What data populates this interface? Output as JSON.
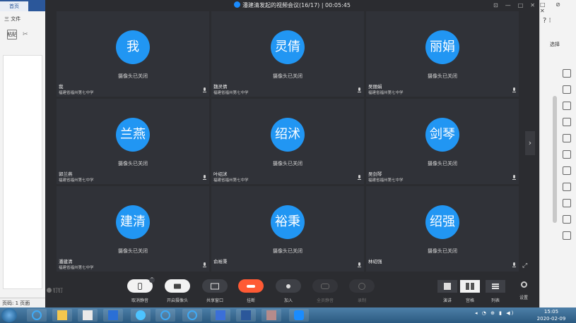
{
  "bg_word_left": {
    "home_tab": "首页",
    "file_menu": "三 文件",
    "paste_label": "粘贴",
    "cut_label": "✂",
    "status_page": "页码: 1  页面"
  },
  "bg_word_right": {
    "window_controls": "□ ⊘ ✕",
    "help": "? ⁝",
    "select_label": "选择"
  },
  "meeting": {
    "title": "潘建清发起的视频会议(16/17) | 00:05:45",
    "window_controls": [
      "⊡",
      "—",
      "□",
      "✕"
    ],
    "participants": [
      {
        "avatar_text": "我",
        "camera_status": "摄像头已关闭",
        "name": "我",
        "school": "福建省福州第七中学"
      },
      {
        "avatar_text": "灵倩",
        "camera_status": "摄像头已关闭",
        "name": "魏灵倩",
        "school": "福建省福州第七中学"
      },
      {
        "avatar_text": "丽娟",
        "camera_status": "摄像头已关闭",
        "name": "吴丽娟",
        "school": "福建省福州第七中学"
      },
      {
        "avatar_text": "兰燕",
        "camera_status": "摄像头已关闭",
        "name": "郭兰燕",
        "school": "福建省福州第七中学"
      },
      {
        "avatar_text": "绍沭",
        "camera_status": "摄像头已关闭",
        "name": "叶绍沭",
        "school": "福建省福州第七中学"
      },
      {
        "avatar_text": "剑琴",
        "camera_status": "摄像头已关闭",
        "name": "吴剑琴",
        "school": "福建省福州第七中学"
      },
      {
        "avatar_text": "建清",
        "camera_status": "摄像头已关闭",
        "name": "潘建清",
        "school": "福建省福州第七中学"
      },
      {
        "avatar_text": "裕秉",
        "camera_status": "摄像头已关闭",
        "name": "俞裕秉",
        "school": ""
      },
      {
        "avatar_text": "绍强",
        "camera_status": "摄像头已关闭",
        "name": "林绍强",
        "school": ""
      }
    ],
    "next_page": "›",
    "fullscreen": "⤢",
    "logo_text": "钉钉",
    "toolbar": {
      "unmute": "取消静音",
      "camera_on": "开启摄像头",
      "share_screen": "共享窗口",
      "hang_up": "挂断",
      "add": "加入",
      "mute_all": "全员静音",
      "record": "录制",
      "view_speaker": "演讲",
      "view_gallery": "宫格",
      "view_list": "列表",
      "settings": "设置"
    }
  },
  "taskbar": {
    "tray": "◂ ◔ ⊕ ▮ ◀)",
    "time": "15:05",
    "date": "2020-02-09"
  }
}
